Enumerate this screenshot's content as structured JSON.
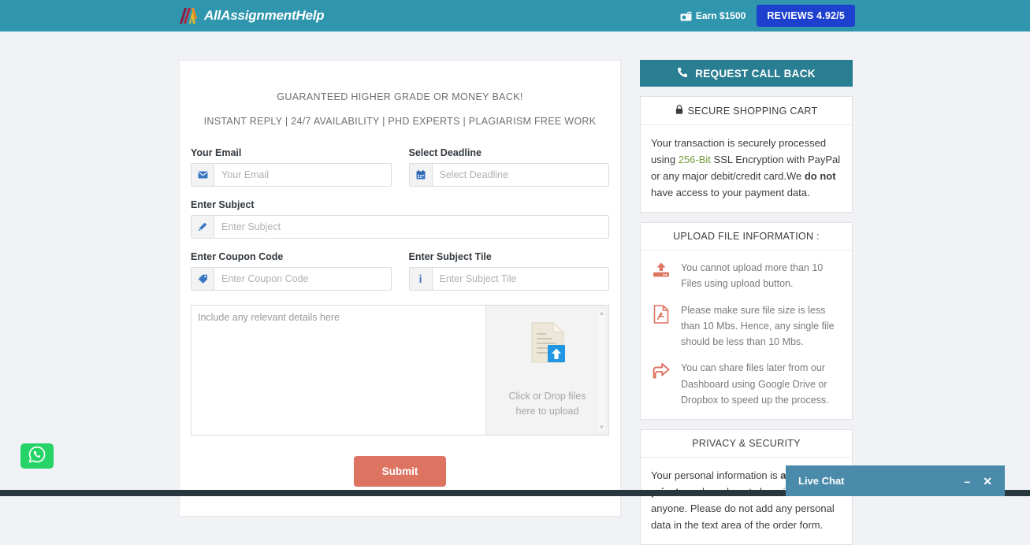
{
  "header": {
    "brand": "AllAssignmentHelp",
    "brand_mark_icon": "aah-logo-icon",
    "earn_label": "Earn $1500",
    "earn_icon": "money-gift-icon",
    "reviews_label": "REVIEWS 4.92/5",
    "colors": {
      "bar": "#2f96ae",
      "reviews_button": "#1e40cf"
    }
  },
  "form": {
    "promo_line1": "GUARANTEED HIGHER GRADE OR MONEY BACK!",
    "promo_line2": "INSTANT REPLY | 24/7 AVAILABILITY | PHD EXPERTS | PLAGIARISM FREE WORK",
    "email": {
      "label": "Your Email",
      "placeholder": "Your Email",
      "value": "",
      "icon": "envelope-icon"
    },
    "deadline": {
      "label": "Select Deadline",
      "placeholder": "Select Deadline",
      "value": "",
      "icon": "calendar-icon"
    },
    "subject": {
      "label": "Enter Subject",
      "placeholder": "Enter Subject",
      "value": "",
      "icon": "pencil-icon"
    },
    "coupon": {
      "label": "Enter Coupon Code",
      "placeholder": "Enter Coupon Code",
      "value": "",
      "icon": "tag-icon"
    },
    "subject_tile": {
      "label": "Enter Subject Tile",
      "placeholder": "Enter Subject Tile",
      "value": "",
      "icon": "info-icon"
    },
    "details": {
      "placeholder": "Include any relevant details here",
      "value": ""
    },
    "dropzone": {
      "line1": "Click or Drop files",
      "line2": "here to upload",
      "icon": "file-upload-icon",
      "scroll_up": "▴",
      "scroll_down": "▾"
    },
    "submit_label": "Submit",
    "submit_color": "#dd7461"
  },
  "sidebar": {
    "callback": {
      "label": "REQUEST CALL BACK",
      "icon": "phone-icon",
      "color": "#2a7e91"
    },
    "secure_cart": {
      "title": "SECURE SHOPPING CART",
      "icon": "lock-icon",
      "text_1": "Your transaction is securely processed using ",
      "highlight": "256-Bit",
      "text_2": " SSL Encryption with PayPal or any major debit/credit card.We ",
      "bold": "do not",
      "text_3": " have access to your payment data.",
      "highlight_color": "#7a9a3e"
    },
    "upload_info": {
      "title": "UPLOAD FILE INFORMATION :",
      "items": [
        {
          "icon": "upload-server-icon",
          "text": "You cannot upload more than 10 Files using upload button."
        },
        {
          "icon": "pdf-file-icon",
          "text": "Please make sure file size is less than 10 Mbs. Hence, any single file should be less than 10 Mbs."
        },
        {
          "icon": "share-arrow-icon",
          "text": "You can share files later from our Dashboard using Google Drive or Dropbox to speed up the process."
        }
      ],
      "icon_color": "#dd7461"
    },
    "privacy": {
      "title": "PRIVACY & SECURITY",
      "text_1": "Your personal information is ",
      "bold": "always kept private",
      "text_2": " and we do not share it with anyone. Please do not add any personal data in the text area of the order form."
    }
  },
  "widgets": {
    "whatsapp": {
      "icon": "whatsapp-icon",
      "color": "#25d366"
    },
    "live_chat": {
      "title": "Live Chat",
      "minimize": "–",
      "close": "✕",
      "color": "#4a8bab"
    }
  }
}
